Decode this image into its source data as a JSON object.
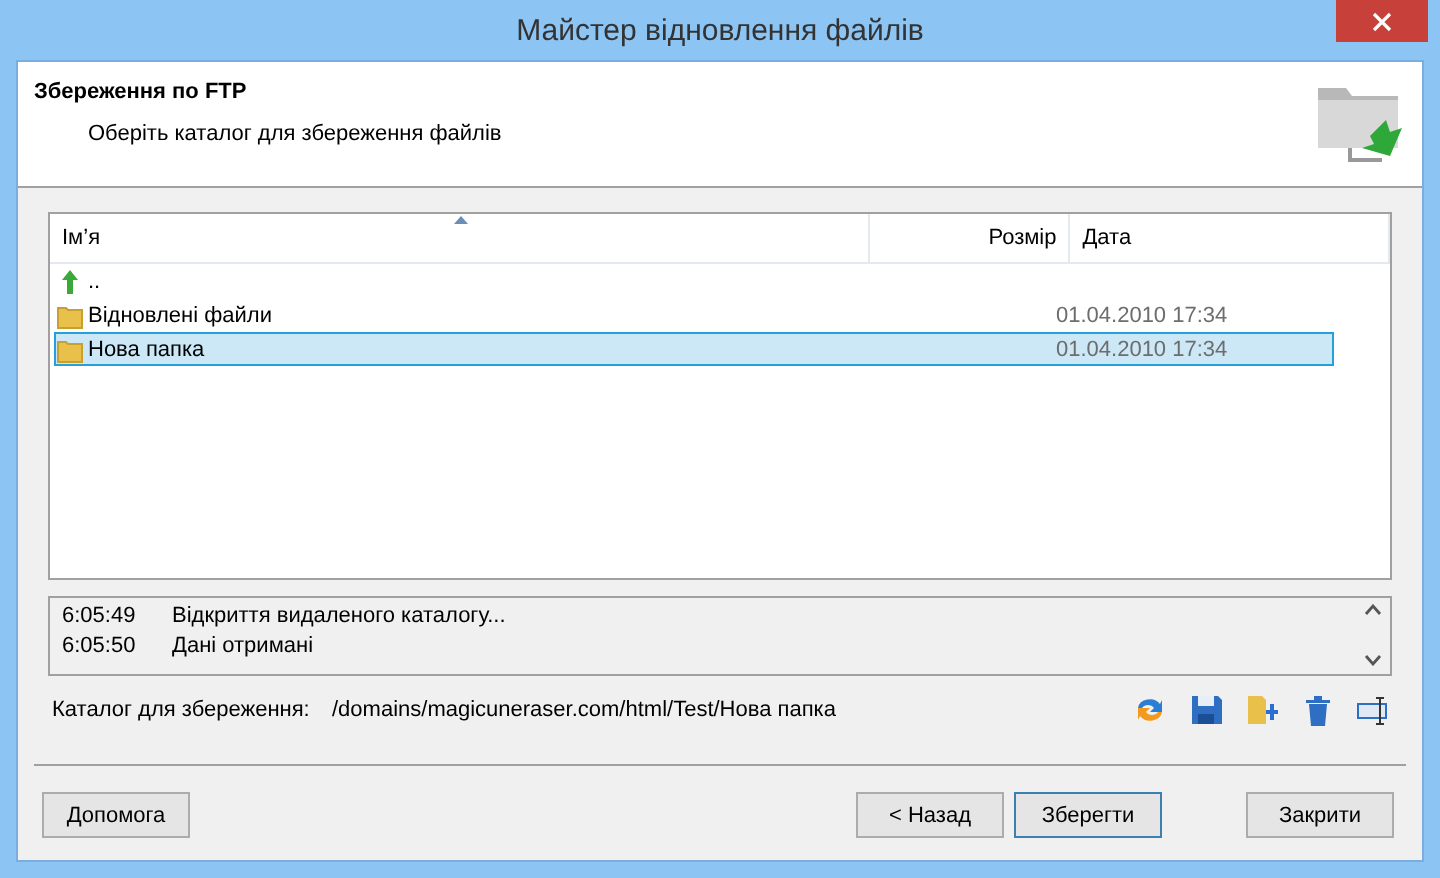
{
  "window": {
    "title": "Майстер відновлення файлів"
  },
  "header": {
    "title": "Збереження по FTP",
    "subtitle": "Оберіть каталог для збереження файлів"
  },
  "table": {
    "columns": [
      "Ім’я",
      "Розмір",
      "Дата"
    ],
    "rows": [
      {
        "kind": "parent",
        "name": "..",
        "selected": false
      },
      {
        "kind": "folder",
        "name": "Відновлені файли",
        "date": "01.04.2010 17:34",
        "selected": false
      },
      {
        "kind": "folder",
        "name": "Нова папка",
        "date": "01.04.2010 17:34",
        "selected": true
      }
    ]
  },
  "log": [
    {
      "time": "6:05:49",
      "message": "Відкриття видаленого каталогу..."
    },
    {
      "time": "6:05:50",
      "message": "Дані отримані"
    }
  ],
  "path": {
    "label": "Каталог для збереження:",
    "value": "/domains/magicuneraser.com/html/Test/Нова папка"
  },
  "buttons": {
    "help": "Допомога",
    "back": "< Назад",
    "save": "Зберегти",
    "close": "Закрити"
  }
}
